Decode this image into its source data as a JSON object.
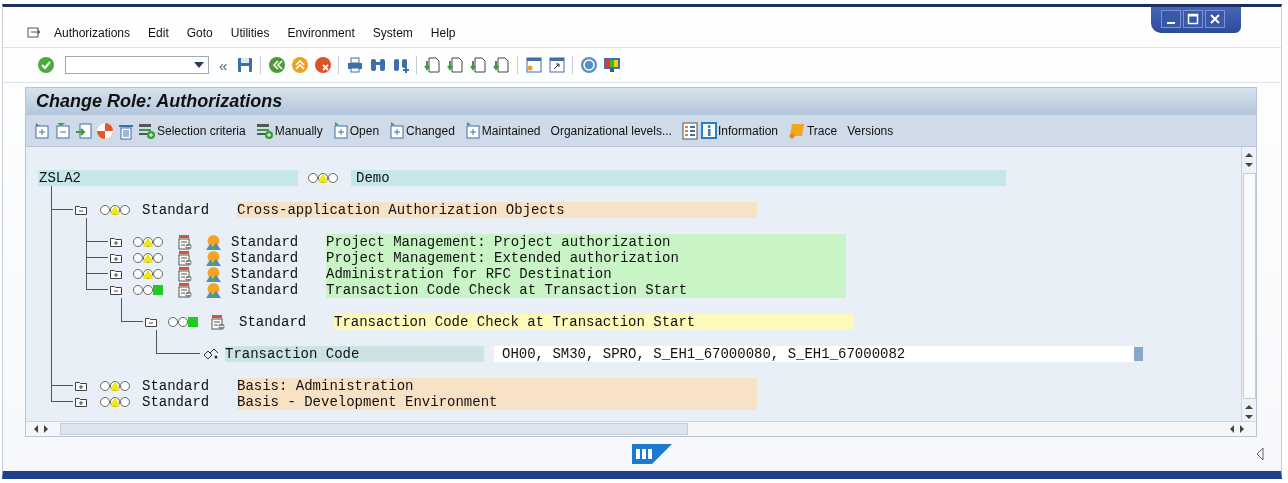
{
  "window": {
    "title": "Change Role: Authorizations"
  },
  "menu": [
    "Authorizations",
    "Edit",
    "Goto",
    "Utilities",
    "Environment",
    "System",
    "Help"
  ],
  "toolbar": {
    "history_mark": "«"
  },
  "app_toolbar": [
    {
      "label": "Selection criteria"
    },
    {
      "label": "Manually"
    },
    {
      "label": "Open"
    },
    {
      "label": "Changed"
    },
    {
      "label": "Maintained"
    },
    {
      "label": "Organizational levels..."
    },
    {
      "label": "Information"
    },
    {
      "label": "Trace"
    },
    {
      "label": "Versions"
    }
  ],
  "tree": {
    "kind": "role",
    "id": "ZSLA2",
    "color": "#f5e800",
    "text": "Demo",
    "children": [
      {
        "kind": "class",
        "expanded": true,
        "color": "#f5e800",
        "maintenance": "Standard",
        "text": "Cross-application Authorization Objects",
        "children": [
          {
            "kind": "object",
            "expanded": false,
            "color": "#f5e800",
            "maintenance": "Standard",
            "text": "Project Management: Project authorization"
          },
          {
            "kind": "object",
            "expanded": false,
            "color": "#f5e800",
            "maintenance": "Standard",
            "text": "Project Management: Extended authorization"
          },
          {
            "kind": "object",
            "expanded": false,
            "color": "#f5e800",
            "maintenance": "Standard",
            "text": "Administration for RFC Destination"
          },
          {
            "kind": "object",
            "expanded": true,
            "color": "#1ecb1e",
            "maintenance": "Standard",
            "text": "Transaction Code Check at Transaction Start",
            "children": [
              {
                "kind": "authorization",
                "expanded": true,
                "color": "#1ecb1e",
                "maintenance": "Standard",
                "text": "Transaction Code Check at Transaction Start",
                "children": [
                  {
                    "kind": "field",
                    "label": "Transaction Code",
                    "value": "OH00, SM30, SPRO, S_EH1_67000080, S_EH1_67000082"
                  }
                ]
              }
            ]
          }
        ]
      },
      {
        "kind": "class",
        "expanded": false,
        "color": "#f5e800",
        "maintenance": "Standard",
        "text": "Basis: Administration"
      },
      {
        "kind": "class",
        "expanded": false,
        "color": "#f5e800",
        "maintenance": "Standard",
        "text": "Basis - Development Environment"
      }
    ]
  }
}
